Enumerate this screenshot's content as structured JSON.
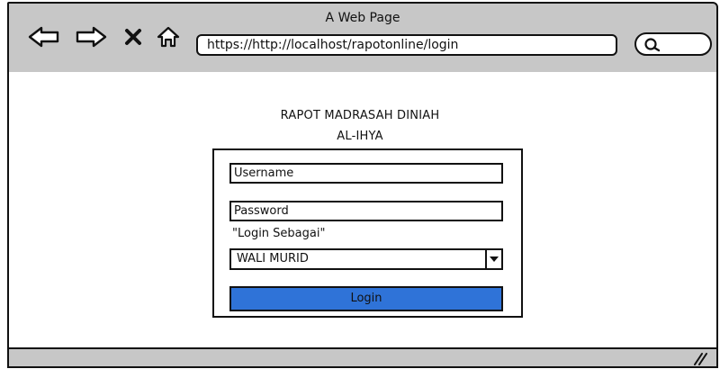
{
  "window": {
    "title": "A Web Page"
  },
  "nav": {
    "icons": [
      "back-arrow-icon",
      "forward-arrow-icon",
      "close-icon",
      "home-icon"
    ]
  },
  "address_bar": {
    "url": "https://http://localhost/rapotonline/login"
  },
  "search": {
    "icon": "search-icon"
  },
  "page": {
    "title_line1": "RAPOT MADRASAH DINIAH",
    "title_line2": "AL-IHYA"
  },
  "form": {
    "username_placeholder": "Username",
    "password_placeholder": "Password",
    "login_as_label": "\"Login Sebagai\"",
    "role_selected": "WALI MURID",
    "login_button": "Login"
  },
  "colors": {
    "chrome_gray": "#c7c7c7",
    "button_blue": "#2f73d8",
    "stroke": "#111111"
  }
}
